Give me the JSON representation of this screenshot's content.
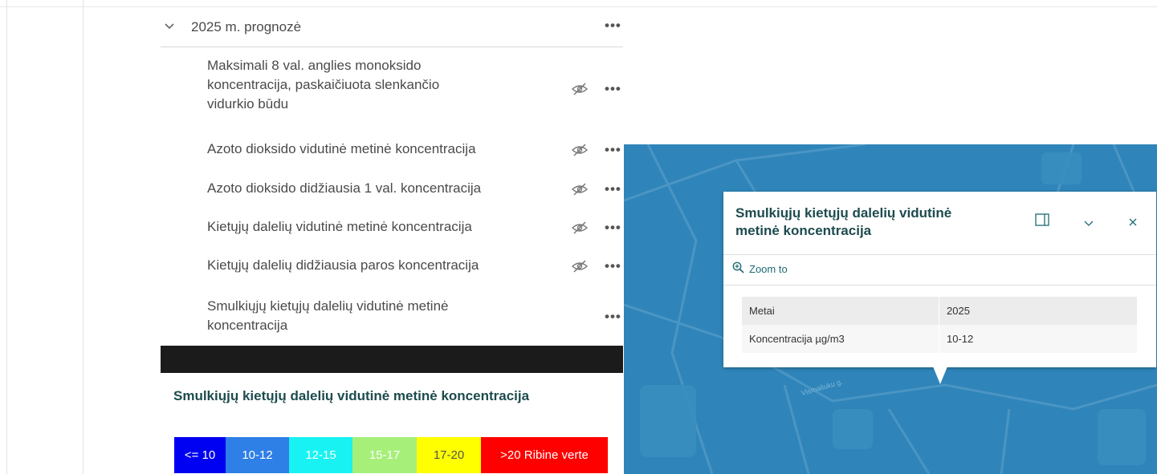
{
  "layer_list": {
    "group_title": "2025 m. prognozė",
    "layers": [
      {
        "title": "Maksimali 8 val. anglies monoksido koncentracija, paskaičiuota slenkančio vidurkio būdu",
        "lines": [
          "Maksimali 8 val. anglies monoksido",
          "koncentracija, paskaičiuota slenkančio",
          "vidurkio būdu"
        ],
        "hidden": true
      },
      {
        "title": "Azoto dioksido vidutinė metinė koncentracija",
        "hidden": true
      },
      {
        "title": "Azoto dioksido didžiausia 1 val. koncentracija",
        "hidden": true
      },
      {
        "title": "Kietųjų dalelių vidutinė metinė koncentracija",
        "hidden": true
      },
      {
        "title": "Kietųjų dalelių didžiausia paros koncentracija",
        "hidden": true
      },
      {
        "title": "Smulkiųjų kietųjų dalelių vidutinė metinė koncentracija",
        "lines": [
          "Smulkiųjų kietųjų dalelių vidutinė metinė",
          "koncentracija"
        ],
        "hidden": false
      }
    ],
    "menu_glyph": "•••"
  },
  "legend": {
    "title": "Smulkiųjų kietųjų dalelių vidutinė metinė koncentracija",
    "classes": [
      {
        "label": "<= 10",
        "color": "#0000f2",
        "text_color": "#ffffff"
      },
      {
        "label": "10-12",
        "color": "#2e7fe6",
        "text_color": "#ffffff"
      },
      {
        "label": "12-15",
        "color": "#18f2f2",
        "text_color": "#ffffff"
      },
      {
        "label": "15-17",
        "color": "#a6f07a",
        "text_color": "#ffffff"
      },
      {
        "label": "17-20",
        "color": "#ffff00",
        "text_color": "#555555"
      },
      {
        "label": ">20 Ribine verte",
        "color": "#ff0000",
        "text_color": "#ffffff"
      }
    ]
  },
  "popup": {
    "title_lines": [
      "Smulkiųjų kietųjų dalelių vidutinė",
      "metinė koncentracija"
    ],
    "zoom_label": "Zoom to",
    "rows": [
      {
        "field": "Metai",
        "value": "2025"
      },
      {
        "field": "Koncentracija µg/m3",
        "value": "10-12"
      }
    ],
    "icons": [
      "dock-icon",
      "chevron-down-icon",
      "close-icon"
    ]
  },
  "map": {
    "street_label": "Vismaliuku g.",
    "water_color": "#2f85b9"
  }
}
